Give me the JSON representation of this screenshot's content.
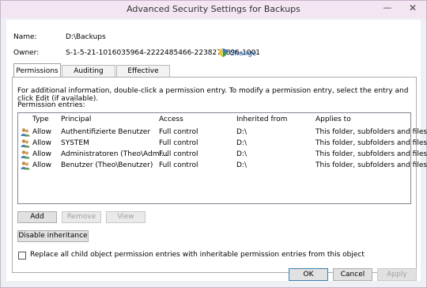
{
  "window": {
    "title": "Advanced Security Settings for Backups",
    "minimize_glyph": "—",
    "close_glyph": "✕"
  },
  "object": {
    "name_label": "Name:",
    "name_value": "D:\\Backups",
    "owner_label": "Owner:",
    "owner_value": "S-1-5-21-1016035964-2222485466-2238272896-1001",
    "change_label": "Change"
  },
  "tabs": [
    {
      "label": "Permissions",
      "active": true
    },
    {
      "label": "Auditing",
      "active": false
    },
    {
      "label": "Effective Access",
      "active": false
    }
  ],
  "permissions": {
    "info_text": "For additional information, double-click a permission entry. To modify a permission entry, select the entry and click Edit (if available).",
    "entries_label": "Permission entries:",
    "columns": [
      "Type",
      "Principal",
      "Access",
      "Inherited from",
      "Applies to"
    ],
    "rows": [
      {
        "type": "Allow",
        "principal": "Authentifizierte Benutzer",
        "access": "Full control",
        "inherited": "D:\\",
        "applies": "This folder, subfolders and files"
      },
      {
        "type": "Allow",
        "principal": "SYSTEM",
        "access": "Full control",
        "inherited": "D:\\",
        "applies": "This folder, subfolders and files"
      },
      {
        "type": "Allow",
        "principal": "Administratoren (Theo\\Admi...",
        "access": "Full control",
        "inherited": "D:\\",
        "applies": "This folder, subfolders and files"
      },
      {
        "type": "Allow",
        "principal": "Benutzer (Theo\\Benutzer)",
        "access": "Full control",
        "inherited": "D:\\",
        "applies": "This folder, subfolders and files"
      }
    ],
    "add_label": "Add",
    "remove_label": "Remove",
    "view_label": "View",
    "disable_inheritance_label": "Disable inheritance",
    "replace_checkbox_label": "Replace all child object permission entries with inheritable permission entries from this object",
    "replace_checked": false
  },
  "footer": {
    "ok_label": "OK",
    "cancel_label": "Cancel",
    "apply_label": "Apply"
  },
  "colors": {
    "title_bar": "#f3e6f2",
    "link": "#1e5fb5",
    "ok_border": "#3c7fb1"
  },
  "icons": {
    "shield": "uac-shield-icon",
    "user": "user-group-icon"
  }
}
